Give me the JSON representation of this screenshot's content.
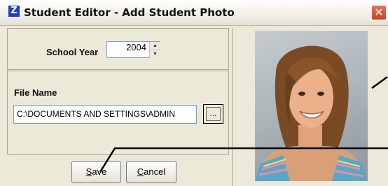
{
  "window": {
    "title": "Student Editor - Add Student Photo",
    "app_icon_glyph": "Z",
    "close_glyph": "✕"
  },
  "school_year": {
    "label": "School Year",
    "value": "2004"
  },
  "file_name": {
    "label": "File Name",
    "value": "C:\\DOCUMENTS AND SETTINGS\\ADMIN",
    "browse_label": "..."
  },
  "buttons": {
    "save_accel": "S",
    "save_rest": "ave",
    "cancel_accel": "C",
    "cancel_rest": "ancel"
  },
  "colors": {
    "accent_icon": "#1f3ec9",
    "close_button": "#c7401f"
  },
  "icons": [
    "app-logo-icon",
    "close-icon",
    "spin-up-icon",
    "spin-down-icon",
    "student-photo"
  ]
}
